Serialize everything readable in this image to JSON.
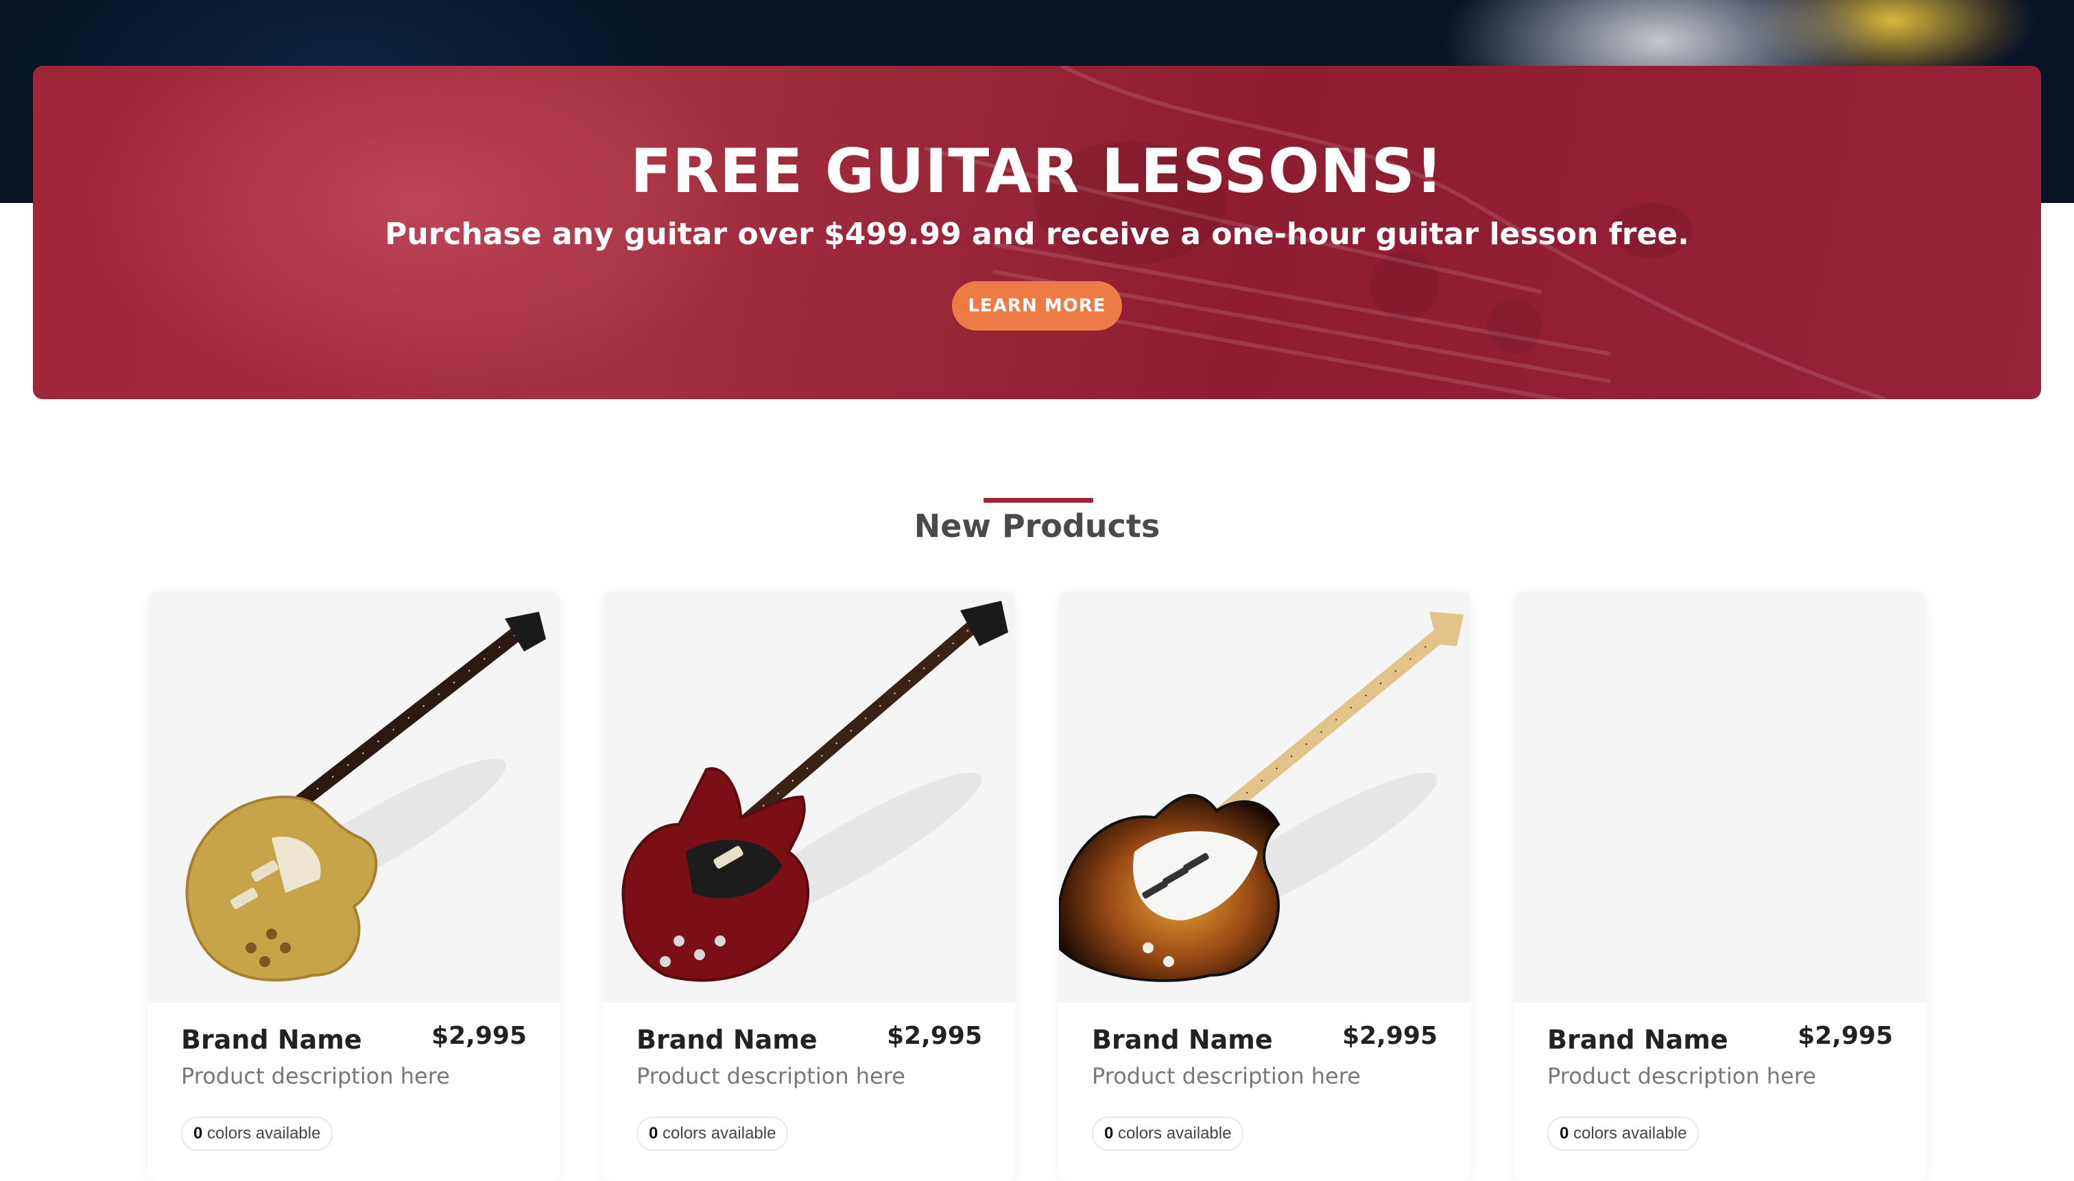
{
  "promo": {
    "title": "FREE GUITAR LESSONS!",
    "subtitle": "Purchase any guitar over $499.99 and receive a one-hour guitar lesson free.",
    "button_label": "LEARN MORE"
  },
  "section": {
    "title": "New Products"
  },
  "products": [
    {
      "brand": "Brand Name",
      "price": "$2,995",
      "description": "Product description here",
      "colors_count": "0",
      "colors_label": "colors available",
      "image": "gold-les-paul-guitar"
    },
    {
      "brand": "Brand Name",
      "price": "$2,995",
      "description": "Product description here",
      "colors_count": "0",
      "colors_label": "colors available",
      "image": "red-sg-guitar"
    },
    {
      "brand": "Brand Name",
      "price": "$2,995",
      "description": "Product description here",
      "colors_count": "0",
      "colors_label": "colors available",
      "image": "sunburst-strat-guitar"
    },
    {
      "brand": "Brand Name",
      "price": "$2,995",
      "description": "Product description here",
      "colors_count": "0",
      "colors_label": "colors available",
      "image": "empty"
    }
  ],
  "colors": {
    "banner": "#9e2639",
    "button": "#ee7a45",
    "accent_rule": "#9e2639",
    "card_image_bg": "#f5f5f5"
  }
}
